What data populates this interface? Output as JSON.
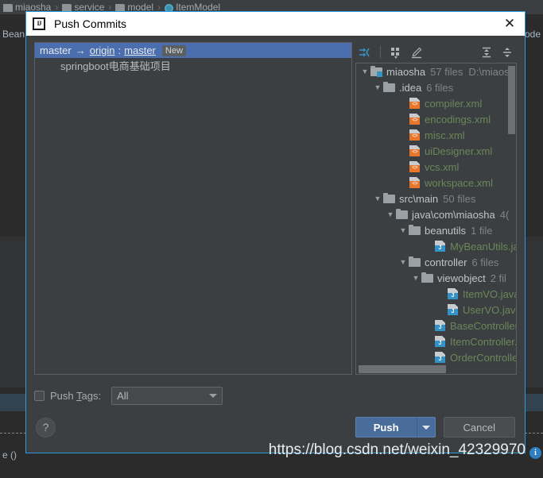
{
  "background": {
    "breadcrumb": [
      {
        "icon": "folder-icon",
        "label": "miaosha"
      },
      {
        "icon": "folder-icon",
        "label": "service"
      },
      {
        "icon": "folder-icon",
        "label": "model"
      },
      {
        "icon": "class-icon",
        "label": "ItemModel"
      }
    ],
    "separator": "›",
    "code_left_top": "Bean",
    "code_left_bottom": "e ()",
    "code_right_top": "lode"
  },
  "dialog": {
    "title": "Push Commits",
    "app_icon": "intellij-idea-icon",
    "close_icon": "close-icon",
    "commits": {
      "header": {
        "source_branch": "master",
        "arrow": "→",
        "remote": "origin",
        "colon": ":",
        "target_branch": "master",
        "badge": "New"
      },
      "items": [
        {
          "message": "springboot电商基础项目"
        }
      ]
    },
    "tree_toolbar": [
      {
        "name": "show-diff-icon",
        "title": "Show Diff"
      },
      {
        "name": "group-by-icon",
        "title": "Group By"
      },
      {
        "name": "edit-source-icon",
        "title": "Edit Source"
      },
      {
        "name": "expand-all-icon",
        "title": "Expand All"
      },
      {
        "name": "collapse-all-icon",
        "title": "Collapse All"
      }
    ],
    "tree": [
      {
        "depth": 0,
        "twisty": "▼",
        "icon": "folder-module-icon",
        "name": "miaosha",
        "count": "57 files",
        "path": "D:\\miaosh",
        "color": "plain"
      },
      {
        "depth": 1,
        "twisty": "▼",
        "icon": "folder-icon",
        "name": ".idea",
        "count": "6 files",
        "path": "",
        "color": "plain"
      },
      {
        "depth": 3,
        "twisty": "",
        "icon": "xml-file-icon",
        "name": "compiler.xml",
        "count": "",
        "path": "",
        "color": "green"
      },
      {
        "depth": 3,
        "twisty": "",
        "icon": "xml-file-icon",
        "name": "encodings.xml",
        "count": "",
        "path": "",
        "color": "green"
      },
      {
        "depth": 3,
        "twisty": "",
        "icon": "xml-file-icon",
        "name": "misc.xml",
        "count": "",
        "path": "",
        "color": "green"
      },
      {
        "depth": 3,
        "twisty": "",
        "icon": "xml-file-icon",
        "name": "uiDesigner.xml",
        "count": "",
        "path": "",
        "color": "green"
      },
      {
        "depth": 3,
        "twisty": "",
        "icon": "xml-file-icon",
        "name": "vcs.xml",
        "count": "",
        "path": "",
        "color": "green"
      },
      {
        "depth": 3,
        "twisty": "",
        "icon": "xml-file-icon",
        "name": "workspace.xml",
        "count": "",
        "path": "",
        "color": "green"
      },
      {
        "depth": 1,
        "twisty": "▼",
        "icon": "folder-icon",
        "name": "src\\main",
        "count": "50 files",
        "path": "",
        "color": "plain"
      },
      {
        "depth": 2,
        "twisty": "▼",
        "icon": "folder-icon",
        "name": "java\\com\\miaosha",
        "count": "4(",
        "path": "",
        "color": "plain"
      },
      {
        "depth": 3,
        "twisty": "▼",
        "icon": "folder-icon",
        "name": "beanutils",
        "count": "1 file",
        "path": "",
        "color": "plain"
      },
      {
        "depth": 5,
        "twisty": "",
        "icon": "java-file-icon",
        "name": "MyBeanUtils.ja",
        "count": "",
        "path": "",
        "color": "green"
      },
      {
        "depth": 3,
        "twisty": "▼",
        "icon": "folder-icon",
        "name": "controller",
        "count": "6 files",
        "path": "",
        "color": "plain"
      },
      {
        "depth": 4,
        "twisty": "▼",
        "icon": "folder-icon",
        "name": "viewobject",
        "count": "2 fil",
        "path": "",
        "color": "plain"
      },
      {
        "depth": 6,
        "twisty": "",
        "icon": "java-file-icon",
        "name": "ItemVO.java",
        "count": "",
        "path": "",
        "color": "green"
      },
      {
        "depth": 6,
        "twisty": "",
        "icon": "java-file-icon",
        "name": "UserVO.java",
        "count": "",
        "path": "",
        "color": "green"
      },
      {
        "depth": 5,
        "twisty": "",
        "icon": "java-file-icon",
        "name": "BaseController",
        "count": "",
        "path": "",
        "color": "green"
      },
      {
        "depth": 5,
        "twisty": "",
        "icon": "java-file-icon",
        "name": "ItemController.",
        "count": "",
        "path": "",
        "color": "green"
      },
      {
        "depth": 5,
        "twisty": "",
        "icon": "java-file-icon",
        "name": "OrderControlle",
        "count": "",
        "path": "",
        "color": "green"
      }
    ],
    "options": {
      "push_tags_checked": false,
      "push_tags_label_pre": "Push ",
      "push_tags_label_mnemonic": "T",
      "push_tags_label_post": "ags:",
      "tags_value": "All",
      "tags_options": [
        "All"
      ]
    },
    "footer": {
      "help_label": "?",
      "push_label": "Push",
      "cancel_label": "Cancel"
    }
  },
  "watermark": {
    "url": "https://blog.csdn.net/weixin_42329970",
    "badge": "i"
  },
  "colors": {
    "accent_blue": "#4b6eaf",
    "dialog_border": "#2d9bdb",
    "panel_bg": "#3c3f41",
    "editor_bg": "#2b2b2b",
    "file_green": "#6a8759",
    "xml_orange": "#e8762c",
    "java_blue": "#3592c4"
  }
}
